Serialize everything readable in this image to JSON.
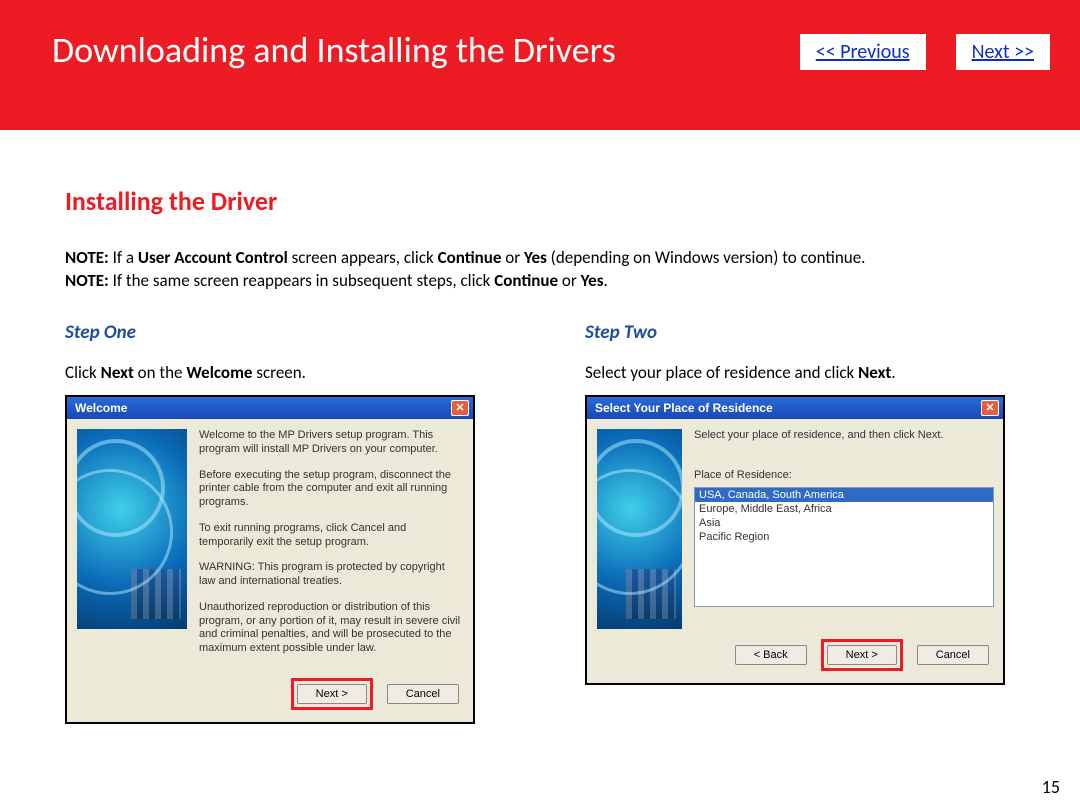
{
  "header": {
    "title": "Downloading and Installing  the Drivers",
    "prev": "<< Previous",
    "next": "Next >>"
  },
  "section_title": "Installing the Driver",
  "notes": {
    "l1_prefix": "NOTE: ",
    "l1_a": "If a ",
    "l1_b": "User Account Control",
    "l1_c": " screen appears, click ",
    "l1_d": "Continue",
    "l1_e": " or ",
    "l1_f": "Yes",
    "l1_g": " (depending on Windows version) to continue.",
    "l2_prefix": "NOTE: ",
    "l2_a": "If the same screen reappears in subsequent steps, click ",
    "l2_b": "Continue",
    "l2_c": " or ",
    "l2_d": "Yes",
    "l2_e": "."
  },
  "step1": {
    "title": "Step One",
    "desc_a": "Click ",
    "desc_b": "Next",
    "desc_c": " on the ",
    "desc_d": "Welcome",
    "desc_e": " screen.",
    "dlg_title": "Welcome",
    "p1": "Welcome to the MP Drivers setup program. This program will install MP Drivers on your computer.",
    "p2": "Before executing the setup program, disconnect the printer cable from the computer and exit all running programs.",
    "p3": "To exit running programs, click Cancel and temporarily exit the setup program.",
    "p4": "WARNING: This program is protected by copyright law and international treaties.",
    "p5": "Unauthorized reproduction or distribution of this program, or any portion of it, may result in severe civil and criminal penalties, and will be prosecuted to the maximum extent possible under law.",
    "next_btn": "Next >",
    "cancel_btn": "Cancel"
  },
  "step2": {
    "title": "Step Two",
    "desc_a": "Select your place of residence and click ",
    "desc_b": "Next",
    "desc_c": ".",
    "dlg_title": "Select Your Place of Residence",
    "instr": "Select your place of residence, and then click Next.",
    "label": "Place of Residence:",
    "options": [
      "USA, Canada, South America",
      "Europe, Middle East, Africa",
      "Asia",
      "Pacific Region"
    ],
    "back_btn": "< Back",
    "next_btn": "Next >",
    "cancel_btn": "Cancel"
  },
  "page_number": "15"
}
